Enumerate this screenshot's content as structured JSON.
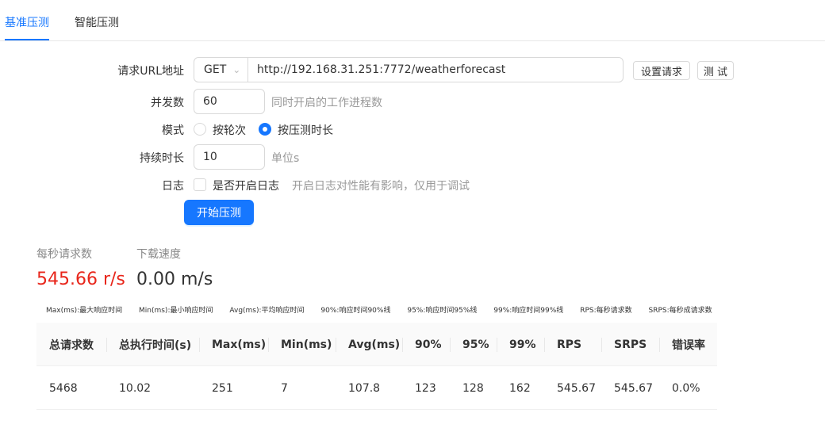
{
  "tabs": [
    {
      "label": "基准压测",
      "active": true
    },
    {
      "label": "智能压测",
      "active": false
    }
  ],
  "form": {
    "url_label": "请求URL地址",
    "method": "GET",
    "url": "http://192.168.31.251:7772/weatherforecast",
    "settings_button": "设置请求",
    "test_button": "测 试",
    "concurrency_label": "并发数",
    "concurrency_value": "60",
    "concurrency_hint": "同时开启的工作进程数",
    "mode_label": "模式",
    "mode_options": [
      {
        "label": "按轮次",
        "checked": false
      },
      {
        "label": "按压测时长",
        "checked": true
      }
    ],
    "duration_label": "持续时长",
    "duration_value": "10",
    "duration_hint": "单位s",
    "log_label": "日志",
    "log_checkbox_label": "是否开启日志",
    "log_checked": false,
    "log_hint": "开启日志对性能有影响，仅用于调试",
    "start_button": "开始压测"
  },
  "stats": {
    "rps_title": "每秒请求数",
    "rps_value": "545.66 r/s",
    "rps_color": "#e8261b",
    "speed_title": "下载速度",
    "speed_value": "0.00 m/s"
  },
  "legend": [
    "Max(ms):最大响应时间",
    "Min(ms):最小响应时间",
    "Avg(ms):平均响应时间",
    "90%:响应时间90%线",
    "95%:响应时间95%线",
    "99%:响应时间99%线",
    "RPS:每秒请求数",
    "SRPS:每秒成请求数"
  ],
  "table": {
    "headers": [
      "总请求数",
      "总执行时间(s)",
      "Max(ms)",
      "Min(ms)",
      "Avg(ms)",
      "90%",
      "95%",
      "99%",
      "RPS",
      "SRPS",
      "错误率"
    ],
    "rows": [
      [
        "5468",
        "10.02",
        "251",
        "7",
        "107.8",
        "123",
        "128",
        "162",
        "545.67",
        "545.67",
        "0.0%"
      ]
    ]
  },
  "colors": {
    "accent": "#1677ff"
  }
}
